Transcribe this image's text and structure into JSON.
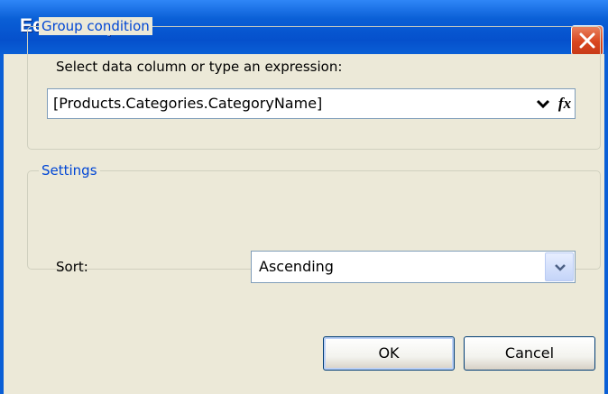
{
  "window": {
    "title": "Edit Group"
  },
  "group_condition": {
    "legend": "Group condition",
    "prompt": "Select data column or type an expression:",
    "expression_value": "[Products.Categories.CategoryName]",
    "fx_label": "fx"
  },
  "settings": {
    "legend": "Settings",
    "sort_label": "Sort:",
    "sort_value": "Ascending"
  },
  "buttons": {
    "ok": "OK",
    "cancel": "Cancel"
  }
}
